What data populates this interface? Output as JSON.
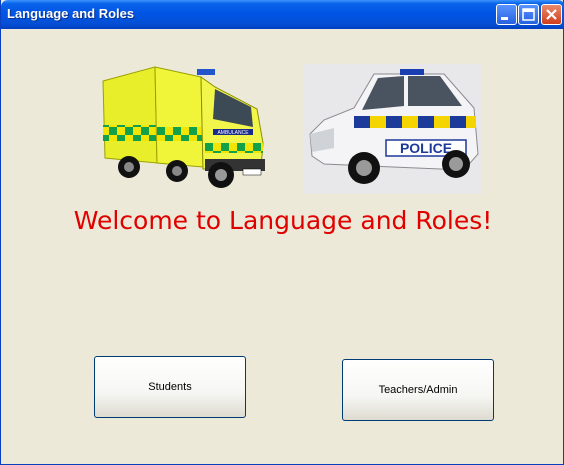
{
  "window": {
    "title": "Language and Roles"
  },
  "images": {
    "ambulance": {
      "icon": "ambulance-photo",
      "label": "AMBULANCE"
    },
    "police": {
      "icon": "police-car-photo",
      "label": "POLICE"
    }
  },
  "welcome": "Welcome to Language and Roles!",
  "buttons": {
    "students": "Students",
    "teachers": "Teachers/Admin"
  },
  "colors": {
    "welcome_text": "#e00000",
    "titlebar": "#0055e5",
    "background": "#ece9d8"
  }
}
